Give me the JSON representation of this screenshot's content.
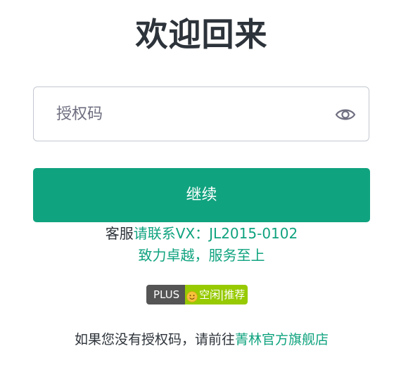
{
  "title": "欢迎回来",
  "auth_input": {
    "placeholder": "授权码",
    "value": ""
  },
  "icons": {
    "eye": "eye-icon",
    "smile": "smile-icon"
  },
  "continue_label": "继续",
  "contact": {
    "prefix": "客服",
    "text": "请联系VX：JL2015-0102"
  },
  "slogan": "致力卓越，服务至上",
  "badge": {
    "left": "PLUS",
    "right": "空闲|推荐"
  },
  "footer": {
    "text": "如果您没有授权码，请前往",
    "link": "菁林官方旗舰店"
  },
  "colors": {
    "accent": "#10a37f",
    "title": "#2d333a",
    "badge_left": "#555555",
    "badge_right": "#97ca00"
  }
}
